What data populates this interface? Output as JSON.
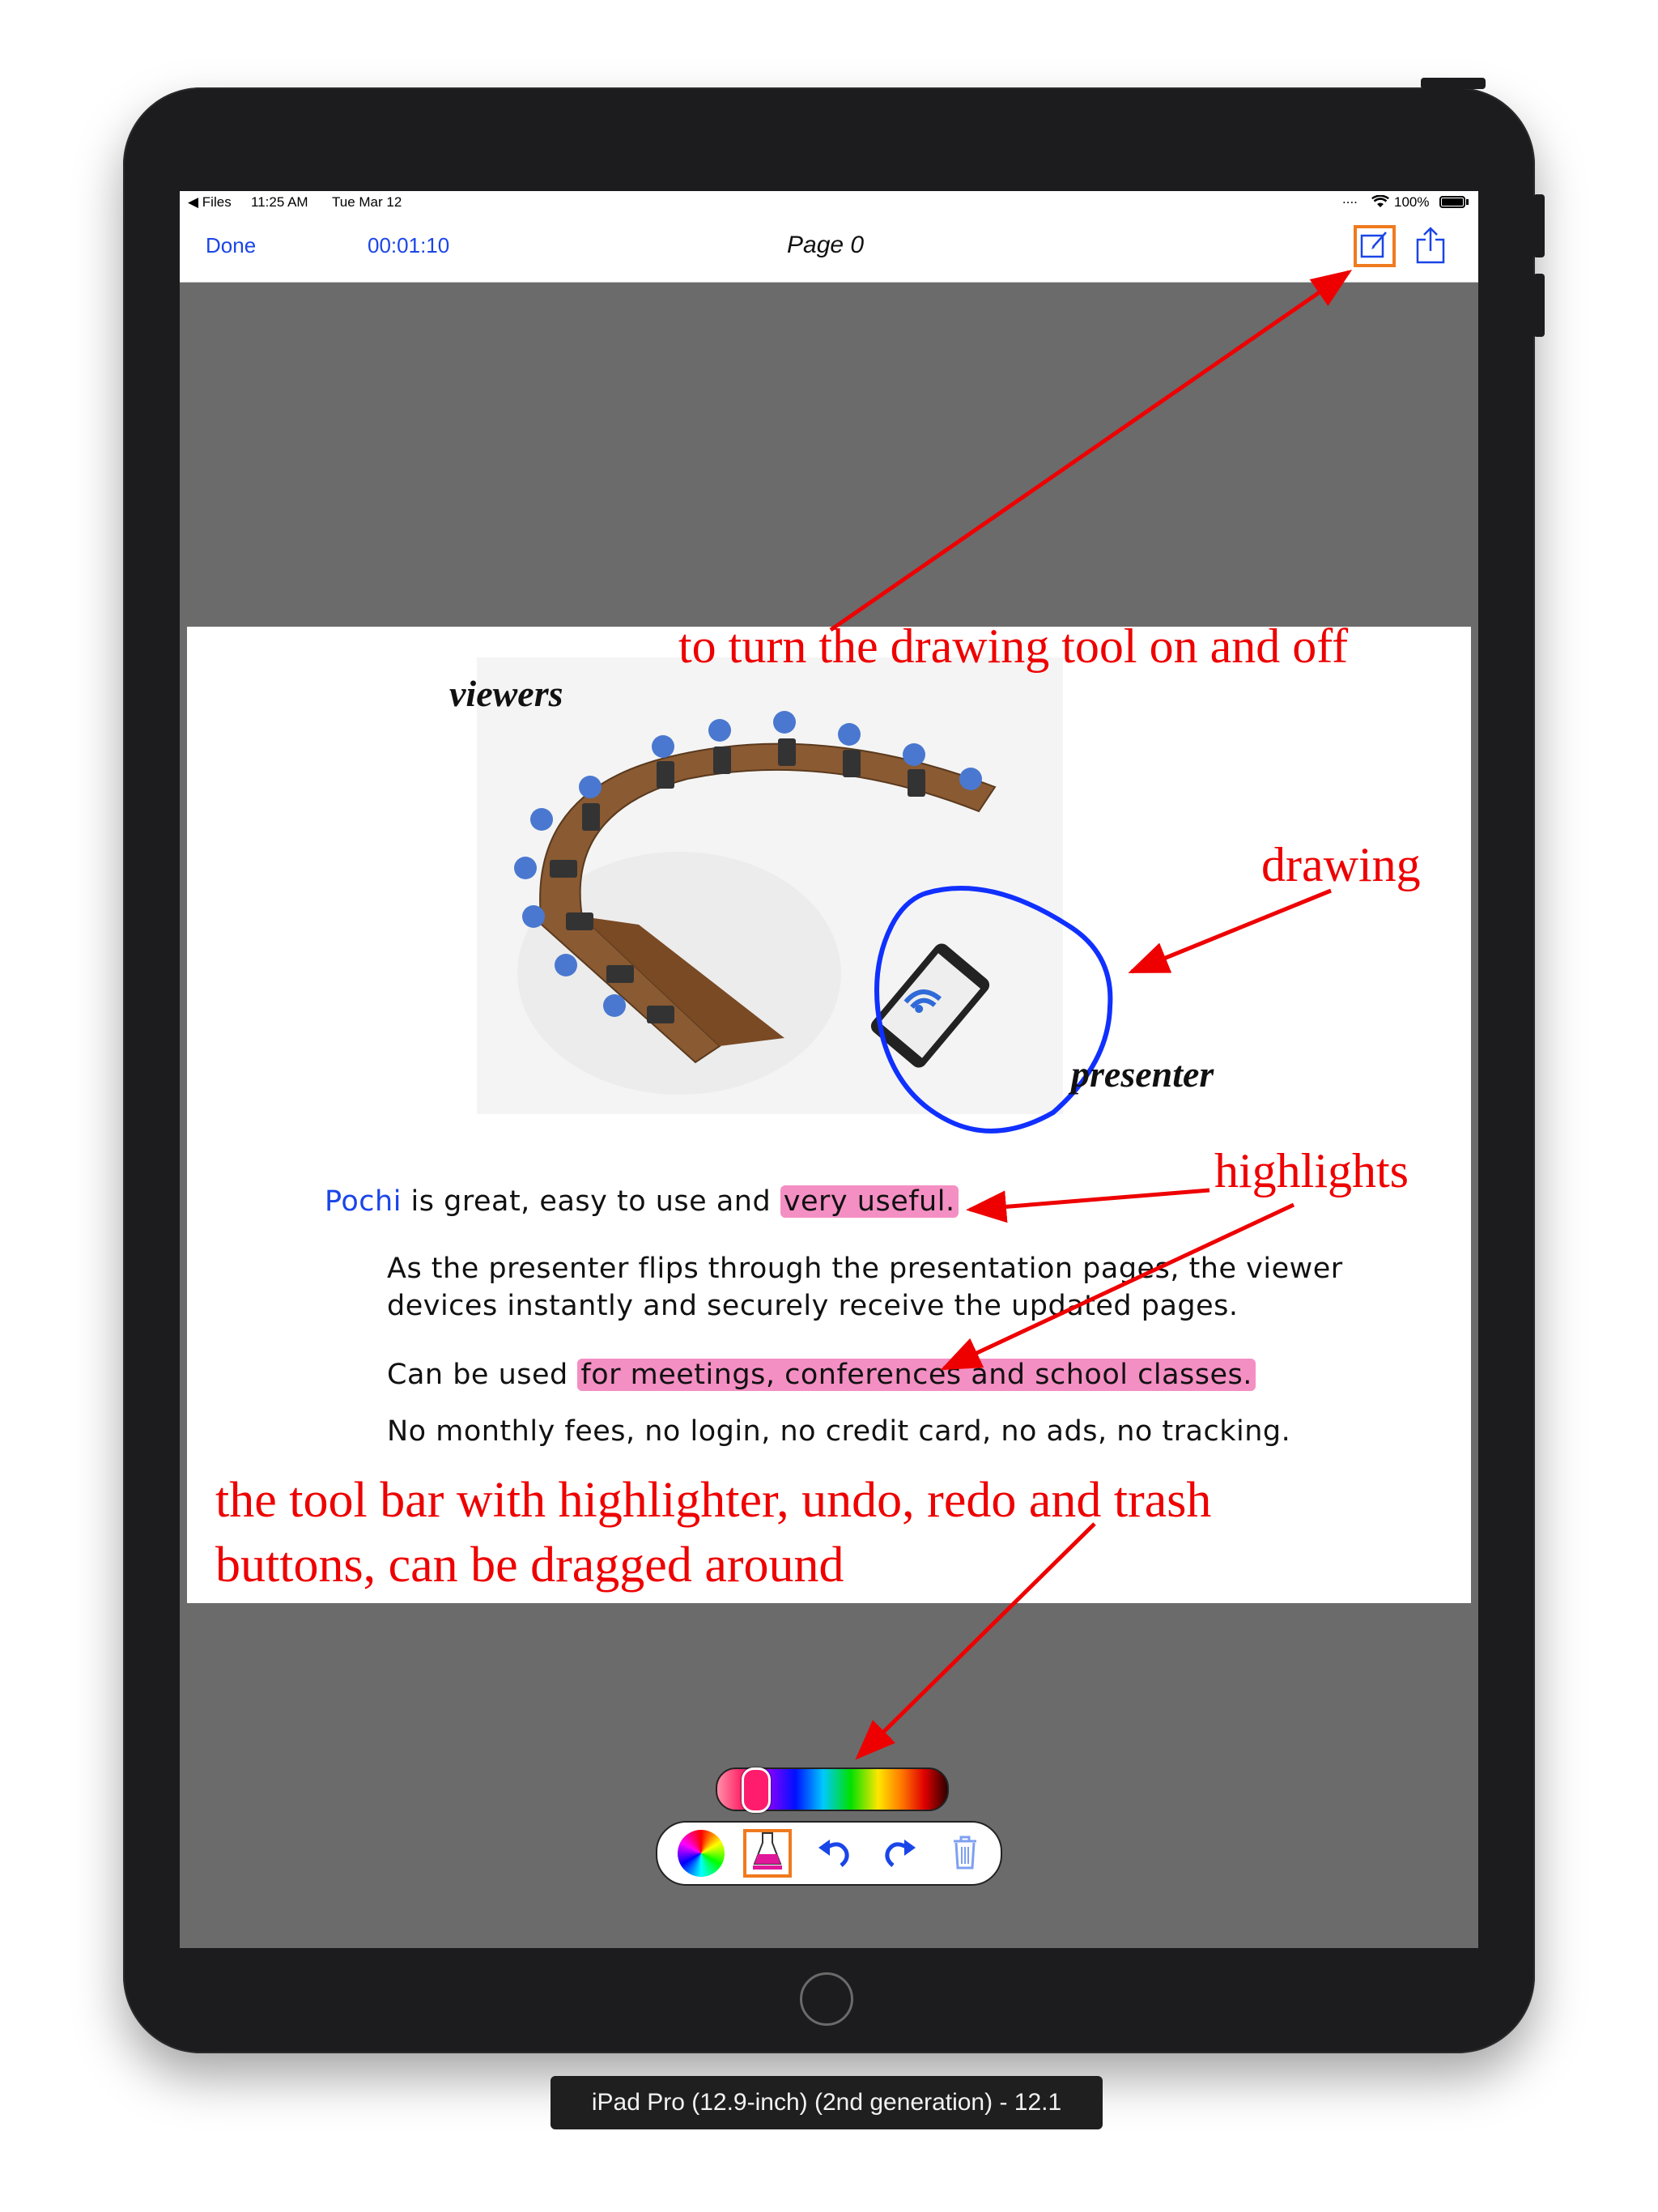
{
  "status_bar": {
    "back_app": "◀ Files",
    "time": "11:25 AM",
    "date": "Tue Mar 12",
    "signal": "....",
    "battery": "100%"
  },
  "nav": {
    "done_label": "Done",
    "timer": "00:01:10",
    "title": "Page 0"
  },
  "slide": {
    "label_viewers": "viewers",
    "label_presenter": "presenter",
    "line1_brand": "Pochi",
    "line1_text": " is great, easy to use and ",
    "line1_highlight": "very useful.",
    "para_line1": "As the presenter flips through the presentation pages, the viewer",
    "para_line2": "devices instantly and securely receive the updated pages.",
    "line3_text": "Can be used ",
    "line3_highlight": "for meetings, conferences and school classes.",
    "line4_text": "No monthly fees, no login, no credit card, no ads, no tracking."
  },
  "annotations": {
    "drawing_tool": "to turn the drawing tool on and off",
    "drawing": "drawing",
    "highlights": "highlights",
    "toolbar_line1": "the tool bar with highlighter, undo, redo and trash",
    "toolbar_line2": "buttons, can be dragged around"
  },
  "toolbar": {
    "tools": [
      "color-wheel",
      "highlighter",
      "undo",
      "redo",
      "trash"
    ],
    "selected_tool": "highlighter",
    "color_slider_value": 0.12
  },
  "colors": {
    "accent": "#1a45e8",
    "annotation": "#ee0000",
    "highlight": "#f069af",
    "drawing_stroke": "#1030ff",
    "selected_outline": "#f07a1e"
  },
  "simulator_label": "iPad Pro (12.9-inch) (2nd generation) - 12.1"
}
